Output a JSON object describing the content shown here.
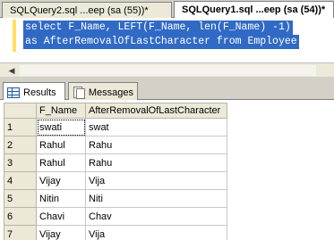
{
  "doc_tabs": [
    {
      "label": "SQLQuery2.sql ...eep (sa (55))*",
      "active": false
    },
    {
      "label": "SQLQuery1.sql ...eep (sa (54))*",
      "active": true
    }
  ],
  "editor": {
    "lines": [
      "select F_Name, LEFT(F_Name, len(F_Name) -1)",
      "as AfterRemovalOfLastCharacter from Employee"
    ]
  },
  "result_tabs": [
    {
      "label": "Results",
      "icon": "grid-icon",
      "active": true
    },
    {
      "label": "Messages",
      "icon": "messages-icon",
      "active": false
    }
  ],
  "grid": {
    "columns": [
      "F_Name",
      "AfterRemovalOfLastCharacter"
    ],
    "rows": [
      {
        "num": "1",
        "cells": [
          "swati",
          "swat"
        ]
      },
      {
        "num": "2",
        "cells": [
          "Rahul",
          "Rahu"
        ]
      },
      {
        "num": "3",
        "cells": [
          "Rahul",
          "Rahu"
        ]
      },
      {
        "num": "4",
        "cells": [
          "Vijay",
          "Vija"
        ]
      },
      {
        "num": "5",
        "cells": [
          "Nitin",
          "Niti"
        ]
      },
      {
        "num": "6",
        "cells": [
          "Chavi",
          "Chav"
        ]
      },
      {
        "num": "7",
        "cells": [
          "Vijay",
          "Vija"
        ]
      }
    ]
  },
  "colors": {
    "selection": "#316ac5",
    "change_marker": "#ffe066"
  }
}
